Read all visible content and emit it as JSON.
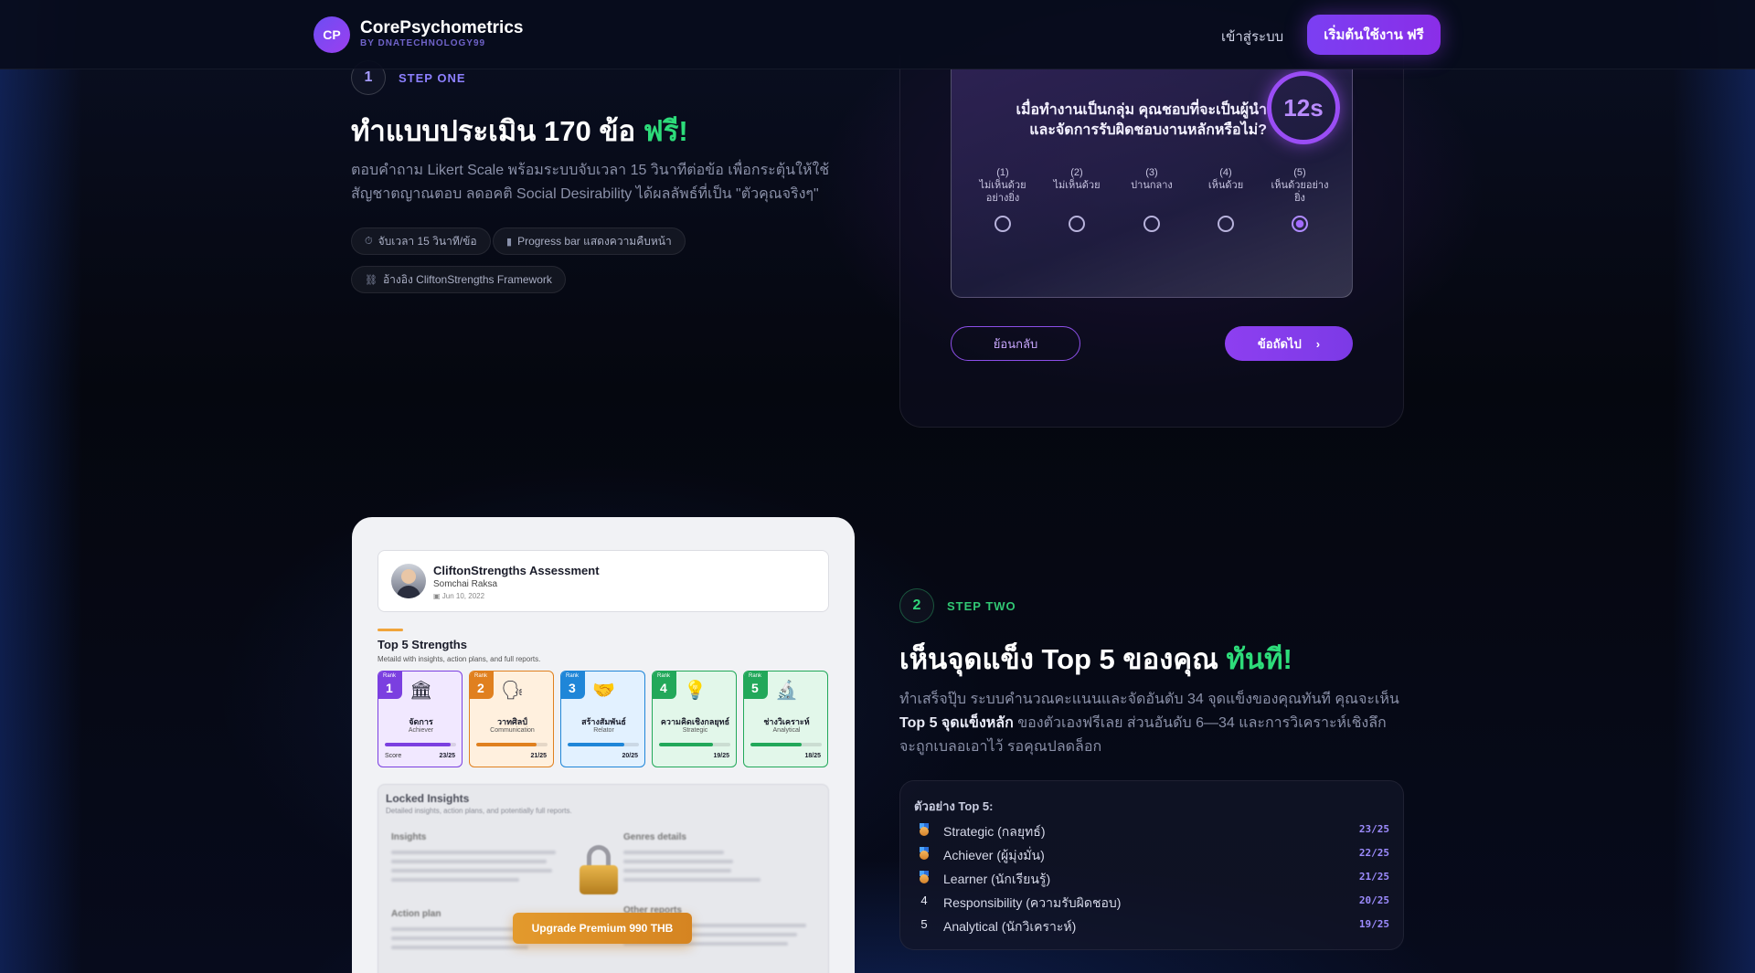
{
  "nav": {
    "logo_badge": "CP",
    "brand": "CorePsychometrics",
    "brand_sub": "BY DNATECHNOLOGY99",
    "login": "เข้าสู่ระบบ",
    "cta": "เริ่มต้นใช้งาน ฟรี"
  },
  "step_one": {
    "number": "1",
    "label": "STEP ONE",
    "title": "ทำแบบประเมิน 170 ข้อ ",
    "title_highlight": "ฟรี!",
    "description": "ตอบคำถาม Likert Scale พร้อมระบบจับเวลา 15 วินาทีต่อข้อ เพื่อกระตุ้นให้ใช้สัญชาตญาณตอบ ลดอคติ Social Desirability ได้ผลลัพธ์ที่เป็น \"ตัวคุณจริงๆ\"",
    "chips": [
      "จับเวลา 15 วินาที/ข้อ",
      "Progress bar แสดงความคืบหน้า",
      "อ้างอิง CliftonStrengths Framework"
    ],
    "quiz": {
      "question": "เมื่อทำงานเป็นกลุ่ม คุณชอบที่จะเป็นผู้นำและจัดการรับผิดชอบงานหลักหรือไม่?",
      "timer": "12s",
      "scale": [
        {
          "num": "(1)",
          "text": "ไม่เห็นด้วยอย่างยิ่ง"
        },
        {
          "num": "(2)",
          "text": "ไม่เห็นด้วย"
        },
        {
          "num": "(3)",
          "text": "ปานกลาง"
        },
        {
          "num": "(4)",
          "text": "เห็นด้วย"
        },
        {
          "num": "(5)",
          "text": "เห็นด้วยอย่างยิ่ง"
        }
      ],
      "selected_index": 4,
      "back": "ย้อนกลับ",
      "next": "ข้อถัดไป"
    }
  },
  "report": {
    "title": "CliftonStrengths Assessment",
    "name": "Somchai Raksa",
    "date": "Jun 10, 2022",
    "top5_title": "Top 5 Strengths",
    "top5_sub": "Metaild with insights, action plans, and full reports.",
    "rank_label": "Rank",
    "score_label": "Score",
    "cards": [
      {
        "rank": "1",
        "th": "จัดการ",
        "en": "Achiever",
        "score": "23/25",
        "value": 23,
        "emoji": "🏛"
      },
      {
        "rank": "2",
        "th": "วาทศิลป์",
        "en": "Communication",
        "score": "21/25",
        "value": 21,
        "emoji": "🗣"
      },
      {
        "rank": "3",
        "th": "สร้างสัมพันธ์",
        "en": "Relator",
        "score": "20/25",
        "value": 20,
        "emoji": "🤝"
      },
      {
        "rank": "4",
        "th": "ความคิดเชิงกลยุทธ์",
        "en": "Strategic",
        "score": "19/25",
        "value": 19,
        "emoji": "💡"
      },
      {
        "rank": "5",
        "th": "ช่างวิเคราะห์",
        "en": "Analytical",
        "score": "18/25",
        "value": 18,
        "emoji": "🔬"
      }
    ],
    "colors": [
      "#7b3fe0",
      "#e0801f",
      "#1f86d8",
      "#22a85a",
      "#22a85a"
    ],
    "locked_title": "Locked Insights",
    "locked_sub": "Detailed insights, action plans, and potentially full reports.",
    "locked_sections": [
      "Insights",
      "Genres details",
      "Action plan",
      "Other reports"
    ],
    "upgrade": "Upgrade Premium 990 THB"
  },
  "step_two": {
    "number": "2",
    "label": "STEP TWO",
    "title": "เห็นจุดแข็ง Top 5 ของคุณ ",
    "title_highlight": "ทันที!",
    "desc_a": "ทำเสร็จปุ๊บ ระบบคำนวณคะแนนและจัดอันดับ 34 จุดแข็งของคุณทันที คุณจะเห็น ",
    "desc_b": "Top 5 จุดแข็งหลัก",
    "desc_c": " ของตัวเองฟรีเลย ส่วนอันดับ 6—34 และการวิเคราะห์เชิงลึกจะถูกเบลอเอาไว้ รอคุณปลดล็อก",
    "box_title": "ตัวอย่าง Top 5:",
    "items": [
      {
        "rank": "1",
        "name": "Strategic (กลยุทธ์)",
        "score": "23/25",
        "medal": true
      },
      {
        "rank": "2",
        "name": "Achiever (ผู้มุ่งมั่น)",
        "score": "22/25",
        "medal": true
      },
      {
        "rank": "3",
        "name": "Learner (นักเรียนรู้)",
        "score": "21/25",
        "medal": true
      },
      {
        "rank": "4",
        "name": "Responsibility (ความรับผิดชอบ)",
        "score": "20/25",
        "medal": false
      },
      {
        "rank": "5",
        "name": "Analytical (นักวิเคราะห์)",
        "score": "19/25",
        "medal": false
      }
    ]
  }
}
